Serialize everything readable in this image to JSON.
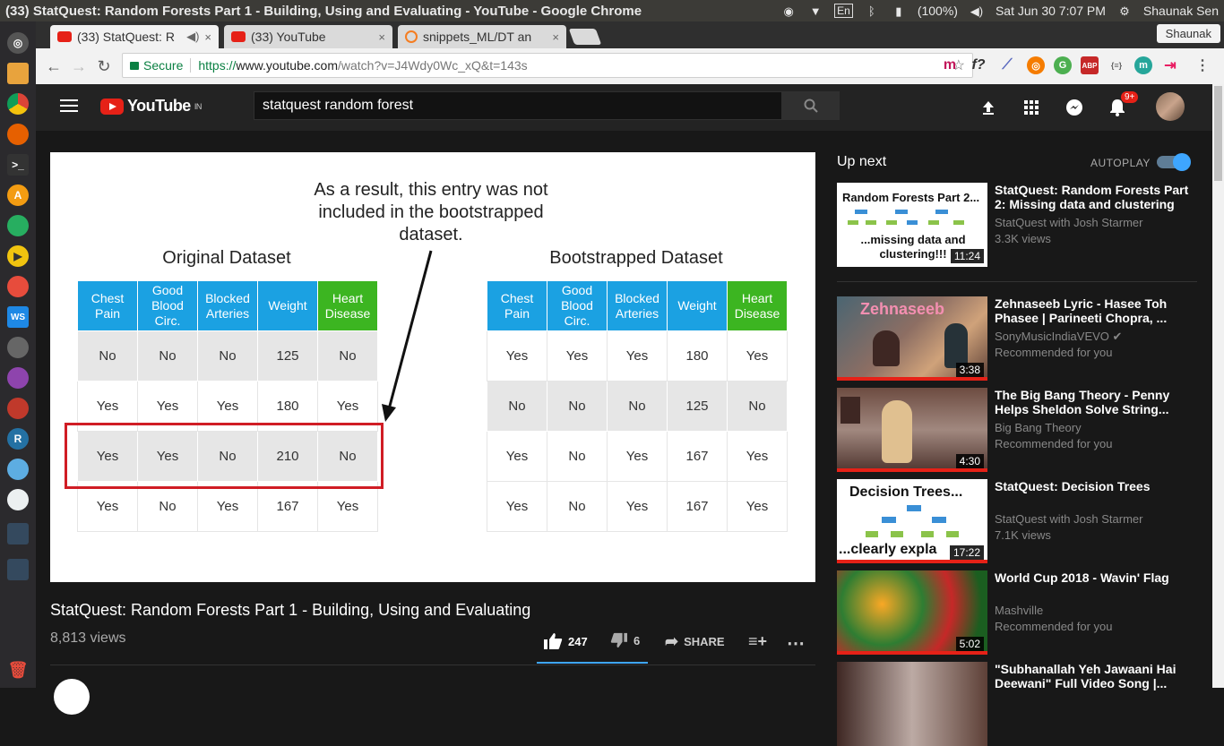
{
  "os_bar": {
    "window_title": "(33) StatQuest: Random Forests Part 1 - Building, Using and Evaluating - YouTube - Google Chrome",
    "lang": "En",
    "battery": "(100%)",
    "clock": "Sat Jun 30  7:07 PM",
    "user": "Shaunak Sen"
  },
  "browser": {
    "tabs": [
      {
        "label": "(33) StatQuest: R",
        "close": "×"
      },
      {
        "label": "(33) YouTube",
        "close": "×"
      },
      {
        "label": "snippets_ML/DT an",
        "close": "×"
      }
    ],
    "profile": "Shaunak",
    "secure_label": "Secure",
    "url_scheme": "https://",
    "url_host": "www.youtube.com",
    "url_path": "/watch?v=J4Wdy0Wc_xQ&t=143s"
  },
  "youtube": {
    "logo_text": "YouTube",
    "region": "IN",
    "search_query": "statquest random forest",
    "notif_count": "9+"
  },
  "slide": {
    "annotation": [
      "As a result, this entry was not",
      "included in the bootstrapped",
      "dataset."
    ],
    "original_title": "Original Dataset",
    "bootstrapped_title": "Bootstrapped Dataset",
    "headers": [
      "Chest Pain",
      "Good Blood Circ.",
      "Blocked Arteries",
      "Weight",
      "Heart Disease"
    ],
    "original_rows": [
      [
        "No",
        "No",
        "No",
        "125",
        "No"
      ],
      [
        "Yes",
        "Yes",
        "Yes",
        "180",
        "Yes"
      ],
      [
        "Yes",
        "Yes",
        "No",
        "210",
        "No"
      ],
      [
        "Yes",
        "No",
        "Yes",
        "167",
        "Yes"
      ]
    ],
    "bootstrapped_rows": [
      [
        "Yes",
        "Yes",
        "Yes",
        "180",
        "Yes"
      ],
      [
        "No",
        "No",
        "No",
        "125",
        "No"
      ],
      [
        "Yes",
        "No",
        "Yes",
        "167",
        "Yes"
      ],
      [
        "Yes",
        "No",
        "Yes",
        "167",
        "Yes"
      ]
    ]
  },
  "video": {
    "title": "StatQuest: Random Forests Part 1 - Building, Using and Evaluating",
    "views": "8,813 views",
    "likes": "247",
    "dislikes": "6",
    "share": "SHARE"
  },
  "sidebar": {
    "up_next": "Up next",
    "autoplay": "AUTOPLAY",
    "autoplay_on": true,
    "recs": [
      {
        "title": "StatQuest: Random Forests Part 2: Missing data and clustering",
        "channel": "StatQuest with Josh Starmer",
        "meta": "3.3K views",
        "duration": "11:24",
        "thumb_top": "Random Forests Part 2...",
        "thumb_bottom": "...missing data and clustering!!!"
      },
      {
        "title": "Zehnaseeb Lyric - Hasee Toh Phasee | Parineeti Chopra, ...",
        "channel": "SonyMusicIndiaVEVO ✔",
        "meta": "Recommended for you",
        "duration": "3:38",
        "thumb_top": "Zehnaseeb",
        "thumb_bottom": ""
      },
      {
        "title": "The Big Bang Theory - Penny Helps Sheldon Solve String...",
        "channel": "Big Bang Theory",
        "meta": "Recommended for you",
        "duration": "4:30",
        "thumb_top": "",
        "thumb_bottom": ""
      },
      {
        "title": "StatQuest: Decision Trees",
        "channel": "StatQuest with Josh Starmer",
        "meta": "7.1K views",
        "duration": "17:22",
        "thumb_top": "Decision Trees...",
        "thumb_bottom": "...clearly expla"
      },
      {
        "title": "World Cup 2018 - Wavin' Flag",
        "channel": "Mashville",
        "meta": "Recommended for you",
        "duration": "5:02",
        "thumb_top": "",
        "thumb_bottom": ""
      },
      {
        "title": "\"Subhanallah Yeh Jawaani Hai Deewani\" Full Video Song |...",
        "channel": "",
        "meta": "",
        "duration": "",
        "thumb_top": "",
        "thumb_bottom": ""
      }
    ]
  }
}
